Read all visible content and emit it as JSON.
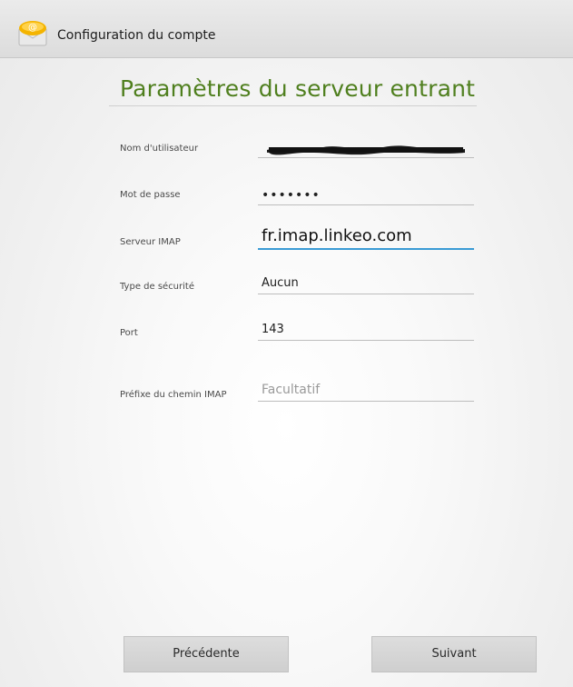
{
  "action_bar": {
    "title": "Configuration du compte",
    "icon": "email-account-icon"
  },
  "screen": {
    "heading": "Paramètres du serveur entrant"
  },
  "form": {
    "username": {
      "label": "Nom d'utilisateur",
      "value": ""
    },
    "password": {
      "label": "Mot de passe",
      "value": "•••••••"
    },
    "server": {
      "label": "Serveur IMAP",
      "value": "fr.imap.linkeo.com"
    },
    "security": {
      "label": "Type de sécurité",
      "value": "Aucun"
    },
    "port": {
      "label": "Port",
      "value": "143"
    },
    "prefix": {
      "label": "Préfixe du chemin IMAP",
      "placeholder": "Facultatif"
    }
  },
  "buttons": {
    "previous": "Précédente",
    "next": "Suivant"
  },
  "colors": {
    "heading": "#4f7f1e",
    "focus_underline": "#3a9bd5",
    "icon_yellow": "#f4b400"
  }
}
